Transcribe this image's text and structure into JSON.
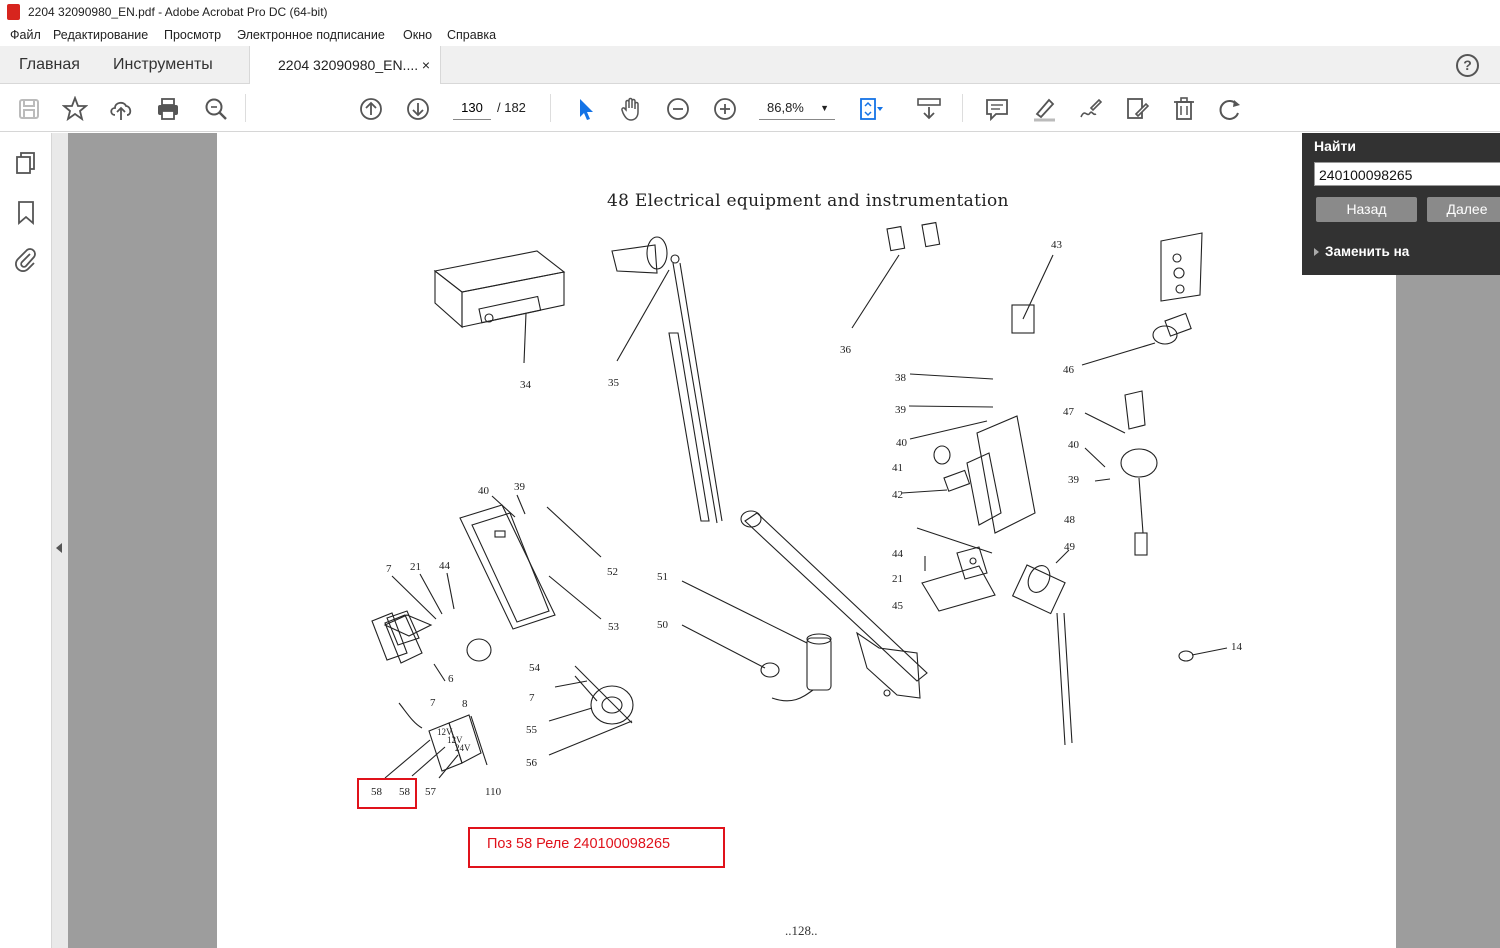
{
  "window": {
    "title": "2204 32090980_EN.pdf - Adobe Acrobat Pro DC (64-bit)"
  },
  "menu": [
    "Файл",
    "Редактирование",
    "Просмотр",
    "Электронное подписание",
    "Окно",
    "Справка"
  ],
  "tabs": {
    "home": "Главная",
    "tools": "Инструменты",
    "document": "2204 32090980_EN....",
    "close": "×"
  },
  "help_icon": "?",
  "navigation": {
    "current_page": "130",
    "total_pages": "/ 182"
  },
  "zoom": {
    "value": "86,8%"
  },
  "find": {
    "label": "Найти",
    "query": "240100098265",
    "back_button": "Назад",
    "next_button": "Далее",
    "replace_label": "Заменить на"
  },
  "page": {
    "title": "48 Electrical equipment and instrumentation",
    "page_number": "..128..",
    "annotation": "Поз 58 Реле 240100098265"
  },
  "part_labels": [
    "34",
    "35",
    "36",
    "43",
    "46",
    "38",
    "39",
    "40",
    "41",
    "42",
    "47",
    "40",
    "39",
    "48",
    "44",
    "21",
    "45",
    "49",
    "14",
    "40",
    "39",
    "52",
    "53",
    "7",
    "21",
    "44",
    "6",
    "7",
    "8",
    "12V",
    "12V",
    "24V",
    "110",
    "54",
    "7",
    "55",
    "56",
    "51",
    "50",
    "58",
    "58",
    "57"
  ],
  "icons": {
    "save": "save-icon",
    "star": "star-icon",
    "upload": "cloud-upload-icon",
    "print": "print-icon",
    "search": "search-icon",
    "prev": "arrow-up-circle-icon",
    "next": "arrow-down-circle-icon",
    "select": "cursor-icon",
    "hand": "hand-icon",
    "zoom_out": "zoom-out-icon",
    "zoom_in": "zoom-in-icon",
    "fit": "fit-page-icon",
    "scroll": "scroll-mode-icon",
    "comment": "comment-icon",
    "highlight": "highlight-icon",
    "sign": "sign-icon",
    "edit": "edit-pdf-icon",
    "delete": "trash-icon",
    "rotate": "rotate-icon",
    "pages": "pages-icon",
    "bookmark": "bookmark-icon",
    "attach": "paperclip-icon"
  },
  "colors": {
    "annotation_red": "#e0121b",
    "find_panel": "#323232",
    "viewer_bg": "#9d9d9d",
    "select_tool": "#1473e6"
  }
}
